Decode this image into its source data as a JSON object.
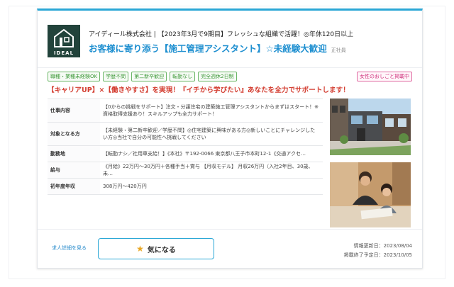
{
  "header": {
    "logo_text": "IDEAL",
    "company_line": "アイディール株式会社 | 【2023年3月で9期目】フレッシュな組織で活躍！◎年休120日以上",
    "job_title": "お客様に寄り添う【施工管理アシスタント】☆未経験大歓迎",
    "employment_type": "正社員"
  },
  "tags": [
    "職種・業種未経験OK",
    "学歴不問",
    "第二新卒歓迎",
    "転勤なし",
    "完全週休2日制"
  ],
  "tag_pink": "女性のおしごと掲載中",
  "catch_copy": "【キャリアUP】×【働きやすさ】を実現！『イチから学びたい』あなたを全力でサポートします！",
  "info_rows": [
    {
      "label": "仕事内容",
      "value": "【0からの挑戦をサポート】注文・分譲住宅の建築施工管理アシスタントからまずはスタート！※資格取得支援あり！スキルアップも全力サポート！"
    },
    {
      "label": "対象となる方",
      "value": "【未経験・第二新卒歓迎／学歴不問】◎住宅建築に興味がある方◎新しいことにチャレンジしたい方◎当社で自分の可能性へ挑戦してください"
    },
    {
      "label": "勤務地",
      "value": "【転勤ナシ／社用車支給！】《本社》〒192-0066 東京都八王子市本町12-1《交通アクセ…"
    },
    {
      "label": "給与",
      "value": "《月給》22万円〜30万円＋各種手当＋賞与 【月収モデル】 月収26万円（入社2年目、30歳、未…"
    },
    {
      "label": "初年度年収",
      "value": "308万円〜420万円"
    }
  ],
  "footer": {
    "detail_link": "求人詳細を見る",
    "favorite_label": "気になる",
    "updated": "情報更新日：2023/08/04",
    "end_date": "掲載終了予定日：2023/10/05"
  },
  "colors": {
    "accent": "#2aa7d6",
    "title": "#1e8fd0",
    "catch": "#d33c2f",
    "tag_green": "#3f9a3a",
    "tag_pink": "#d0337d",
    "logo_bg": "#22433b"
  }
}
